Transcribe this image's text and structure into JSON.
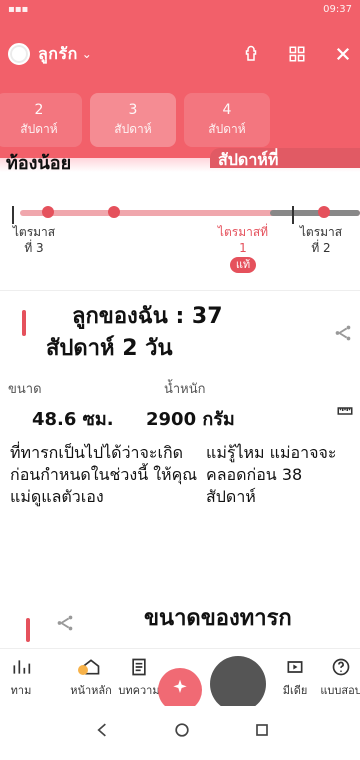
{
  "status_bar": {
    "left": "▪▪▪",
    "right": "09:37"
  },
  "header": {
    "profile_name": "ลูกรัก",
    "caret": "⌄",
    "icons": [
      "baby-icon",
      "grid-icon",
      "close-icon"
    ]
  },
  "week_chips": [
    {
      "line1": "2",
      "line2": "สัปดาห์"
    },
    {
      "line1": "3",
      "line2": "สัปดาห์"
    },
    {
      "line1": "4",
      "line2": "สัปดาห์"
    }
  ],
  "section_top": {
    "left_title": "ท้องน้อย",
    "right_title": "สัปดาห์ที่"
  },
  "timeline": {
    "labels": [
      {
        "text": "ไตรมาส",
        "sub": "ที่ 3"
      },
      {
        "text": "ไตรมาสที่",
        "sub": "1"
      },
      {
        "text": "ไตรมาส",
        "sub": "ที่ 2"
      }
    ],
    "badge": "แท้"
  },
  "card": {
    "title": "ลูกของฉัน : 37",
    "subtitle": "สัปดาห์ 2 วัน",
    "height_label": "ขนาด",
    "height_value": "48.6 ซม.",
    "weight_label": "น้ำหนัก",
    "weight_value": "2900 กรัม",
    "note_left": "ที่ทารกเป็นไปได้ว่าจะเกิดก่อนกำหนดในช่วงนี้ ให้คุณแม่ดูแลตัวเอง",
    "note_right": "แม่รู้ไหม แม่อาจจะคลอดก่อน 38 สัปดาห์"
  },
  "section2": {
    "title": "ขนาดของทารก"
  },
  "bottom_nav": [
    {
      "label": "ทาม",
      "icon": "chart-icon"
    },
    {
      "label": "หน้าหลัก",
      "icon": "home-icon"
    },
    {
      "label": "บทความ",
      "icon": "article-icon"
    },
    {
      "label": "มีเดีย",
      "icon": "media-icon"
    },
    {
      "label": "แบบสอบ",
      "icon": "question-icon"
    }
  ]
}
